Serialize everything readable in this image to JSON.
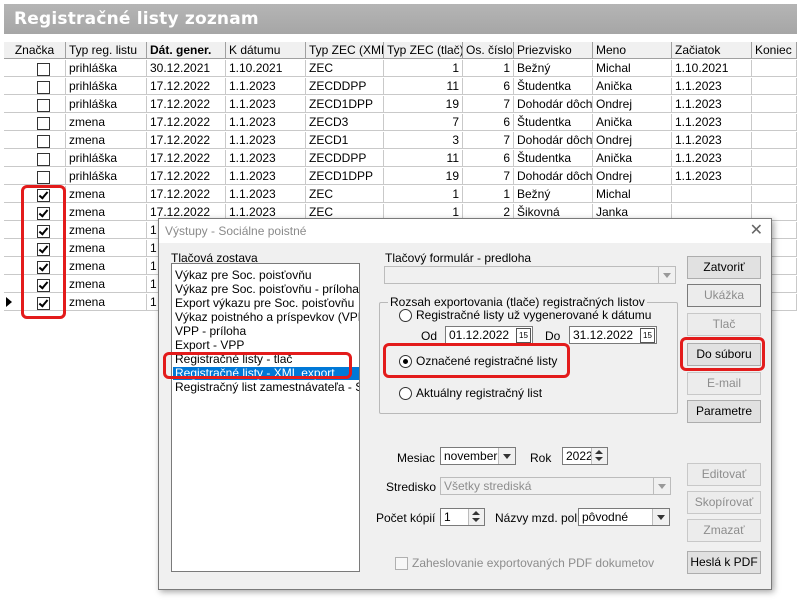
{
  "window": {
    "title": "Registračné listy zoznam"
  },
  "table": {
    "columns": [
      "Značka",
      "Typ reg. listu",
      "Dát. gener.",
      "K dátumu",
      "Typ ZEC (XML)",
      "Typ ZEC (tlač)",
      "Os. číslo",
      "Priezvisko",
      "Meno",
      "Začiatok",
      "Koniec"
    ],
    "rows": [
      {
        "checked": false,
        "typ": "prihláška",
        "dat": "30.12.2021",
        "kdat": "1.10.2021",
        "xml": "ZEC",
        "tlac": "1",
        "os": "1",
        "priez": "Bežný",
        "meno": "Michal",
        "zac": "1.10.2021"
      },
      {
        "checked": false,
        "typ": "prihláška",
        "dat": "17.12.2022",
        "kdat": "1.1.2023",
        "xml": "ZECDDPP",
        "tlac": "11",
        "os": "6",
        "priez": "Študentka",
        "meno": "Anička",
        "zac": "1.1.2023"
      },
      {
        "checked": false,
        "typ": "prihláška",
        "dat": "17.12.2022",
        "kdat": "1.1.2023",
        "xml": "ZECD1DPP",
        "tlac": "19",
        "os": "7",
        "priez": "Dohodár dôcho",
        "meno": "Ondrej",
        "zac": "1.1.2023"
      },
      {
        "checked": false,
        "typ": "zmena",
        "dat": "17.12.2022",
        "kdat": "1.1.2023",
        "xml": "ZECD3",
        "tlac": "7",
        "os": "6",
        "priez": "Študentka",
        "meno": "Anička",
        "zac": "1.1.2023"
      },
      {
        "checked": false,
        "typ": "zmena",
        "dat": "17.12.2022",
        "kdat": "1.1.2023",
        "xml": "ZECD1",
        "tlac": "3",
        "os": "7",
        "priez": "Dohodár dôcho",
        "meno": "Ondrej",
        "zac": "1.1.2023"
      },
      {
        "checked": false,
        "typ": "prihláška",
        "dat": "17.12.2022",
        "kdat": "1.1.2023",
        "xml": "ZECDDPP",
        "tlac": "11",
        "os": "6",
        "priez": "Študentka",
        "meno": "Anička",
        "zac": "1.1.2023"
      },
      {
        "checked": false,
        "typ": "prihláška",
        "dat": "17.12.2022",
        "kdat": "1.1.2023",
        "xml": "ZECD1DPP",
        "tlac": "19",
        "os": "7",
        "priez": "Dohodár dôcho",
        "meno": "Ondrej",
        "zac": "1.1.2023"
      },
      {
        "checked": true,
        "typ": "zmena",
        "dat": "17.12.2022",
        "kdat": "1.1.2023",
        "xml": "ZEC",
        "tlac": "1",
        "os": "1",
        "priez": "Bežný",
        "meno": "Michal",
        "zac": ""
      },
      {
        "checked": true,
        "typ": "zmena",
        "dat": "17.12.2022",
        "kdat": "1.1.2023",
        "xml": "ZEC",
        "tlac": "1",
        "os": "2",
        "priez": "Šikovná",
        "meno": "Janka",
        "zac": ""
      },
      {
        "checked": true,
        "typ": "zmena",
        "dat": "1",
        "kdat": "",
        "xml": "",
        "tlac": "",
        "os": "",
        "priez": "",
        "meno": "",
        "zac": ""
      },
      {
        "checked": true,
        "typ": "zmena",
        "dat": "1",
        "kdat": "",
        "xml": "",
        "tlac": "",
        "os": "",
        "priez": "",
        "meno": "",
        "zac": ""
      },
      {
        "checked": true,
        "typ": "zmena",
        "dat": "1",
        "kdat": "",
        "xml": "",
        "tlac": "",
        "os": "",
        "priez": "",
        "meno": "",
        "zac": ""
      },
      {
        "checked": true,
        "typ": "zmena",
        "dat": "1",
        "kdat": "",
        "xml": "",
        "tlac": "",
        "os": "",
        "priez": "",
        "meno": "",
        "zac": ""
      },
      {
        "checked": true,
        "typ": "zmena",
        "dat": "1",
        "kdat": "",
        "xml": "",
        "tlac": "",
        "os": "",
        "priez": "",
        "meno": "",
        "zac": ""
      }
    ]
  },
  "dialog": {
    "title": "Výstupy - Sociálne poistné",
    "close_icon": "close-icon",
    "report_label": "Tlačová zostava",
    "reports": [
      "Výkaz pre Soc. poisťovňu",
      "Výkaz pre Soc. poisťovňu - príloha",
      "Export výkazu pre Soc. poisťovňu",
      "Výkaz poistného a príspevkov (VPP)",
      "VPP - príloha",
      "Export - VPP",
      "Registračné listy - tlač",
      "Registračné listy - XML export",
      "Registračný list zamestnávateľa - SP"
    ],
    "selected_report_index": 7,
    "form_label": "Tlačový formulár - predloha",
    "form_value": "",
    "range_group": "Rozsah exportovania (tlače) registračných listov",
    "opt_generated": "Registračné listy už vygenerované k dátumu",
    "od_label": "Od",
    "od_value": "01.12.2022",
    "do_label": "Do",
    "do_value": "31.12.2022",
    "cal_glyph": "15",
    "opt_marked": "Označené registračné listy",
    "opt_current": "Aktuálny registračný list",
    "mesiac_label": "Mesiac",
    "mesiac_value": "november",
    "rok_label": "Rok",
    "rok_value": "2022",
    "stredisko_label": "Stredisko",
    "stredisko_value": "Všetky strediská",
    "kopii_label": "Počet kópií",
    "kopii_value": "1",
    "nazvy_label": "Názvy mzd. pol.",
    "nazvy_value": "pôvodné",
    "pdf_label": "Zaheslovanie exportovaných PDF dokumetov",
    "buttons": {
      "zatvorit": "Zatvoriť",
      "ukazka": "Ukážka",
      "tlac": "Tlač",
      "do_suboru": "Do súboru",
      "email": "E-mail",
      "parametre": "Parametre",
      "editovat": "Editovať",
      "skopirovat": "Skopírovať",
      "zmazat": "Zmazať",
      "hesla_pdf": "Heslá k PDF"
    }
  },
  "colors": {
    "highlight": "#e31b1b",
    "selection": "#0078d7",
    "title_bar": "#ababab"
  }
}
